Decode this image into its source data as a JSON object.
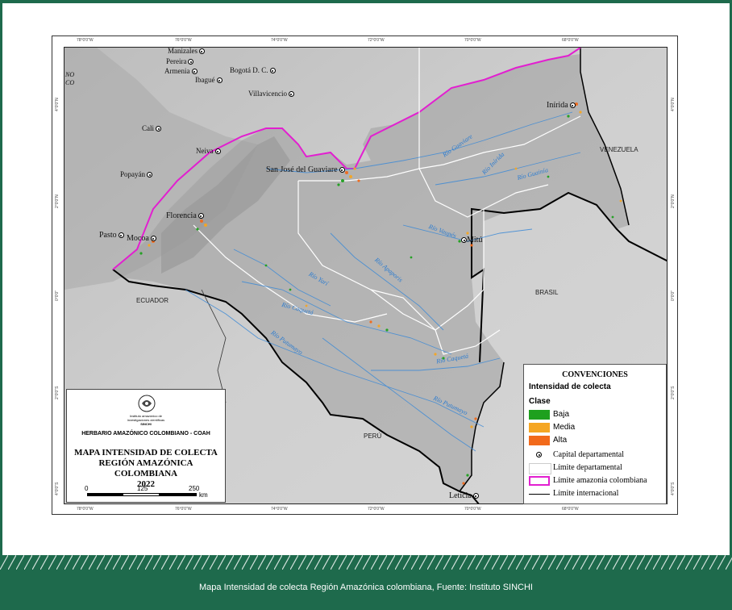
{
  "caption": "Mapa Intensidad de colecta Región Amazónica colombiana, Fuente: Instituto SINCHI",
  "ticks": {
    "top": [
      "78°0'0\"W",
      "76°0'0\"W",
      "74°0'0\"W",
      "72°0'0\"W",
      "70°0'0\"W",
      "68°0'0\"W"
    ],
    "bottom": [
      "78°0'0\"W",
      "76°0'0\"W",
      "74°0'0\"W",
      "72°0'0\"W",
      "70°0'0\"W",
      "68°0'0\"W"
    ],
    "left": [
      "4°0'0\"N",
      "2°0'0\"N",
      "0°0'0\"",
      "2°0'0\"S",
      "4°0'0\"S"
    ],
    "right": [
      "4°0'0\"N",
      "2°0'0\"N",
      "0°0'0\"",
      "2°0'0\"S",
      "4°0'0\"S"
    ]
  },
  "places": {
    "manizales": "Manizales",
    "pereira": "Pereira",
    "armenia": "Armenia",
    "ibague": "Ibagué",
    "bogota": "Bogotá D. C.",
    "villavicencio": "Villavicencio",
    "cali": "Cali",
    "neiva": "Neiva",
    "popayan": "Popayán",
    "sanjose": "San José del Guaviare",
    "florencia": "Florencia",
    "pasto": "Pasto",
    "mocoa": "Mocoa",
    "mitu": "Mitú",
    "inirida": "Inírida",
    "leticia": "Leticia",
    "noco": "NO",
    "noco2": "CO"
  },
  "countries": {
    "venezuela": "VENEZUELA",
    "brasil": "BRASIL",
    "ecuador": "ECUADOR",
    "peru": "PERÚ"
  },
  "rivers": {
    "guaviare": "Río Guaviare",
    "inirida": "Río Inírida",
    "guainia": "Río Guainía",
    "vaupes": "Río Vaupés",
    "apaporis": "Río Apaporis",
    "yari": "Río Yarí",
    "caqueta1": "Río Caquetá",
    "putumayo1": "Río Putumayo",
    "caqueta2": "Río Caquetá",
    "putumayo2": "Río Putumayo"
  },
  "legend": {
    "title": "CONVENCIONES",
    "subtitle": "Intensidad de colecta",
    "clase": "Clase",
    "classes": [
      {
        "label": "Baja",
        "color": "#1ea01e"
      },
      {
        "label": "Media",
        "color": "#f5a623"
      },
      {
        "label": "Alta",
        "color": "#f26a1b"
      }
    ],
    "symbols": {
      "capital": "Capital departamental",
      "departmental": "Límite departamental",
      "amazon": "Límite amazonia colombiana",
      "international": "Límite internacional"
    },
    "amazon_color": "#e21fd0"
  },
  "titlebox": {
    "institute": "Instituto amazónico de",
    "institute2": "investigaciones científicas",
    "institute3": "SINCHI",
    "herbario": "HERBARIO AMAZÓNICO COLOMBIANO - COAH",
    "title1": "MAPA INTENSIDAD DE COLECTA",
    "title2": "REGIÓN AMAZÓNICA COLOMBIANA",
    "year": "2022",
    "scale0": "0",
    "scale1": "125",
    "scale2": "250",
    "scale_unit": "km"
  }
}
